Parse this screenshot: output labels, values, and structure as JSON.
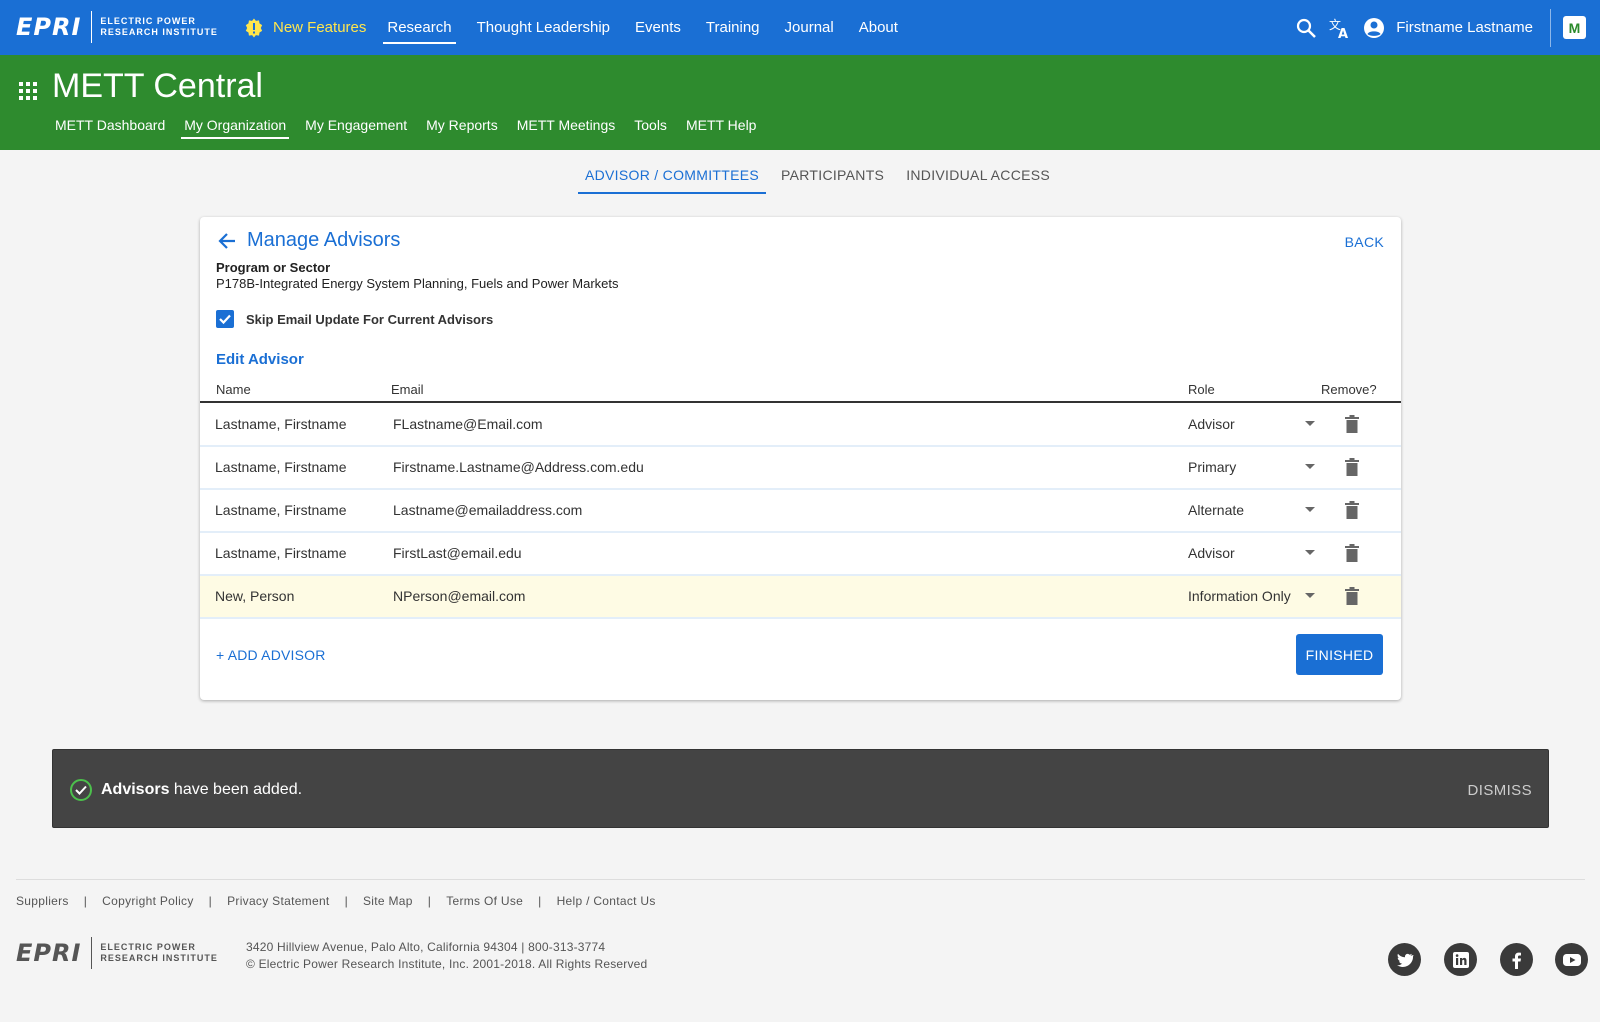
{
  "brand": {
    "logo_mark": "EPRI",
    "logo_text": "ELECTRIC POWER\nRESEARCH INSTITUTE"
  },
  "topnav": {
    "new_features": "New Features",
    "links": [
      "Research",
      "Thought Leadership",
      "Events",
      "Training",
      "Journal",
      "About"
    ],
    "active": "Research",
    "user_name": "Firstname Lastname",
    "app_button": "M"
  },
  "app": {
    "title": "METT Central",
    "subnav": [
      "METT Dashboard",
      "My Organization",
      "My Engagement",
      "My Reports",
      "METT Meetings",
      "Tools",
      "METT Help"
    ],
    "active_subnav": "My Organization"
  },
  "tabs": {
    "items": [
      "ADVISOR / COMMITTEES",
      "PARTICIPANTS",
      "INDIVIDUAL ACCESS"
    ],
    "active": "ADVISOR / COMMITTEES"
  },
  "card": {
    "title": "Manage Advisors",
    "back_label": "BACK",
    "program_label": "Program or Sector",
    "program_value": "P178B-Integrated Energy System Planning, Fuels and Power Markets",
    "skip_label": "Skip Email Update For Current Advisors",
    "skip_checked": true,
    "section_title": "Edit Advisor",
    "columns": {
      "name": "Name",
      "email": "Email",
      "role": "Role",
      "remove": "Remove?"
    },
    "rows": [
      {
        "name": "Lastname, Firstname",
        "email": "FLastname@Email.com",
        "role": "Advisor",
        "is_new": false
      },
      {
        "name": "Lastname, Firstname",
        "email": "Firstname.Lastname@Address.com.edu",
        "role": "Primary",
        "is_new": false
      },
      {
        "name": "Lastname, Firstname",
        "email": "Lastname@emailaddress.com",
        "role": "Alternate",
        "is_new": false
      },
      {
        "name": "Lastname, Firstname",
        "email": "FirstLast@email.edu",
        "role": "Advisor",
        "is_new": false
      },
      {
        "name": "New, Person",
        "email": "NPerson@email.com",
        "role": "Information Only",
        "is_new": true
      }
    ],
    "add_label": "+ ADD ADVISOR",
    "finished_label": "FINISHED"
  },
  "toast": {
    "bold": "Advisors",
    "message": " have been added.",
    "dismiss": "DISMISS"
  },
  "footer": {
    "links": [
      "Suppliers",
      "Copyright Policy",
      "Privacy Statement",
      "Site Map",
      "Terms Of Use",
      "Help / Contact Us"
    ],
    "address": "3420 Hillview Avenue, Palo Alto, California 94304  |  800-313-3774",
    "copyright": "© Electric Power Research Institute, Inc. 2001-2018. All Rights Reserved",
    "social": [
      "twitter-icon",
      "linkedin-icon",
      "facebook-icon",
      "youtube-icon"
    ]
  },
  "colors": {
    "primary_blue": "#1a6fd4",
    "app_green": "#2e8b2e",
    "new_features_yellow": "#ffe64d",
    "new_row_highlight": "#fefbe4",
    "toast_bg": "#444444"
  }
}
